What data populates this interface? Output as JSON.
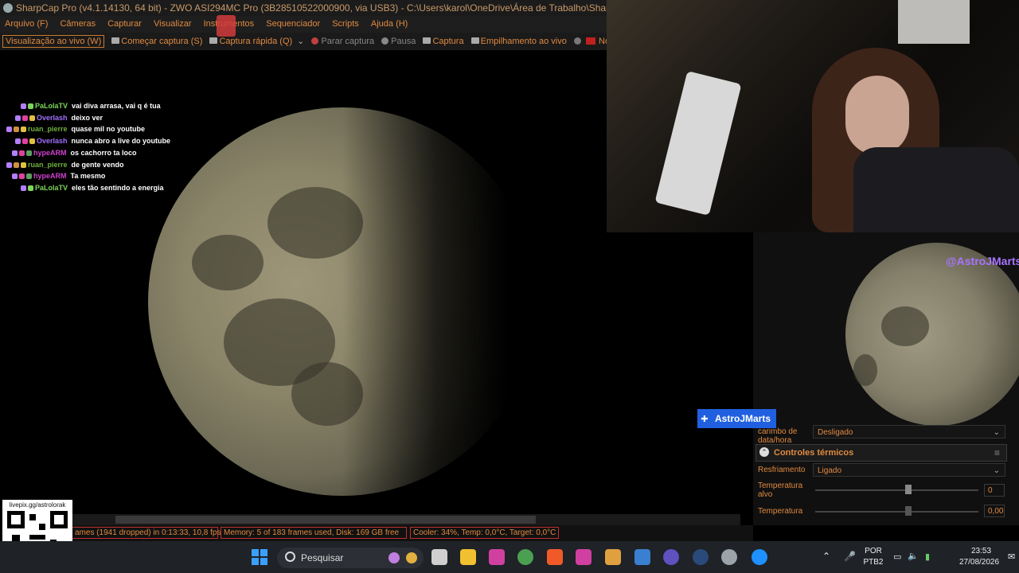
{
  "window": {
    "title": "SharpCap Pro (v4.1.14130, 64 bit) - ZWO ASI294MC Pro (3B28510522000900, via USB3) - C:\\Users\\karol\\OneDrive\\Área de Trabalho\\SharpCap Captures"
  },
  "menu": [
    "Arquivo (F)",
    "Câmeras",
    "Capturar",
    "Visualizar",
    "Instrumentos",
    "Sequenciador",
    "Scripts",
    "Ajuda (H)"
  ],
  "toolbar": {
    "live_view": "Visualização ao vivo (W)",
    "start_capture": "Começar captura (S)",
    "quick_capture": "Captura rápida (Q)",
    "stop_capture": "Parar captura",
    "pause": "Pausa",
    "snapshot": "Captura",
    "live_stack": "Empilhamento ao vivo",
    "target_name": "Nome de destino"
  },
  "chat": [
    {
      "user": "PaLolaTV",
      "color": "#7cd65a",
      "message": "vai diva arrasa, vai q é tua"
    },
    {
      "user": "Overlash",
      "color": "#a070ff",
      "message": "deixo ver"
    },
    {
      "user": "ruan_pierre",
      "color": "#6fae3e",
      "message": "quase mil no youtube"
    },
    {
      "user": "Overlash",
      "color": "#a070ff",
      "message": "nunca abro a live do youtube"
    },
    {
      "user": "hypeARM",
      "color": "#d040d0",
      "message": "os cachorro ta loco"
    },
    {
      "user": "ruan_pierre",
      "color": "#6fae3e",
      "message": "de gente vendo"
    },
    {
      "user": "hypeARM",
      "color": "#d040d0",
      "message": "Ta mesmo"
    },
    {
      "user": "PaLolaTV",
      "color": "#7cd65a",
      "message": "eles tão sentindo a energia"
    }
  ],
  "overlay": {
    "handle": "@AstroJMarts",
    "name_badge": "AstroJMarts",
    "qr_caption": "livepix.gg/astrolorak"
  },
  "panel": {
    "timestamp_label": "carimbo de data/hora",
    "timestamp_value": "Desligado",
    "thermal_section": "Controles térmicos",
    "cooling_label": "Resfriamento",
    "cooling_value": "Ligado",
    "target_temp_label": "Temperatura alvo",
    "target_temp_value": "0",
    "temperature_label": "Temperatura",
    "temperature_value": "0,00"
  },
  "status": {
    "frames": "ames (1941 dropped) in 0:13:33, 10,8 fps",
    "memory": "Memory: 5 of 183 frames used, Disk: 169 GB free",
    "cooler": "Cooler: 34%, Temp: 0,0°C, Target: 0,0°C"
  },
  "taskbar": {
    "search_placeholder": "Pesquisar",
    "lang_top": "POR",
    "lang_bottom": "PTB2",
    "time": "23:53",
    "date": "27/08/2026"
  }
}
